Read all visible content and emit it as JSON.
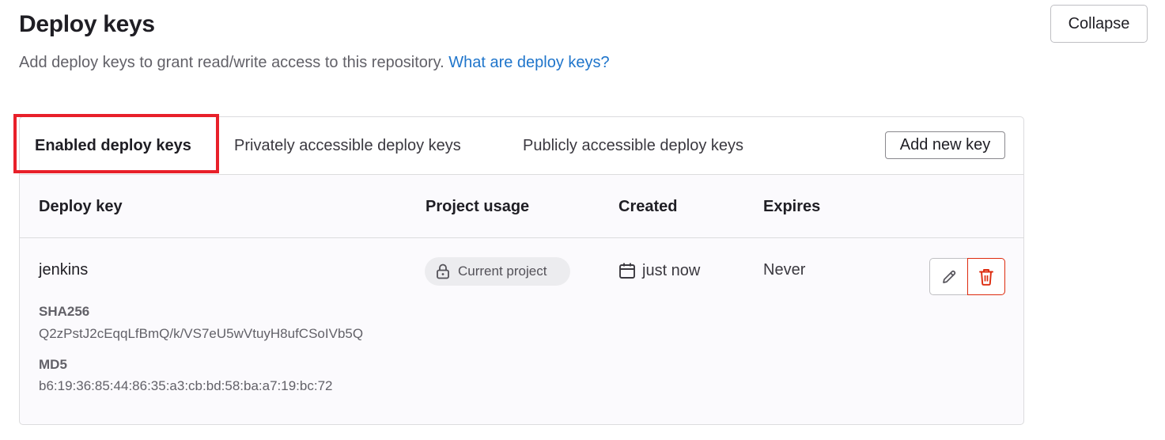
{
  "header": {
    "title": "Deploy keys",
    "description": "Add deploy keys to grant read/write access to this repository.",
    "help_link": "What are deploy keys?",
    "collapse_label": "Collapse"
  },
  "tabs": [
    {
      "label": "Enabled deploy keys",
      "active": true
    },
    {
      "label": "Privately accessible deploy keys",
      "active": false
    },
    {
      "label": "Publicly accessible deploy keys",
      "active": false
    }
  ],
  "add_new_key_label": "Add new key",
  "table": {
    "columns": [
      "Deploy key",
      "Project usage",
      "Created",
      "Expires"
    ],
    "rows": [
      {
        "title": "jenkins",
        "sha256_label": "SHA256",
        "sha256": "Q2zPstJ2cEqqLfBmQ/k/VS7eU5wVtuyH8ufCSoIVb5Q",
        "md5_label": "MD5",
        "md5": "b6:19:36:85:44:86:35:a3:cb:bd:58:ba:a7:19:bc:72",
        "usage": "Current project",
        "usage_icon": "lock-icon",
        "created": "just now",
        "created_icon": "calendar-icon",
        "expires": "Never"
      }
    ]
  },
  "colors": {
    "link": "#1f75cb",
    "danger": "#dd2b0e",
    "highlight": "#e8202a"
  }
}
